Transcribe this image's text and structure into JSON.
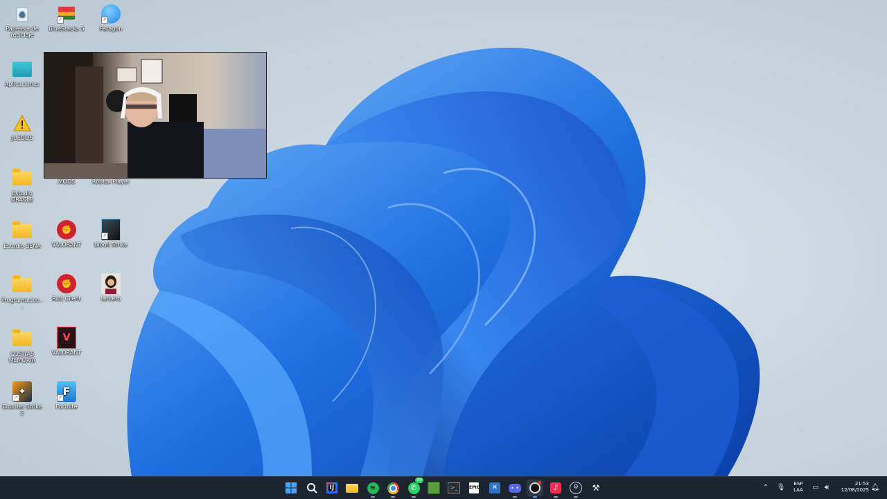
{
  "desktop_icons": [
    {
      "id": "recycle",
      "label": "Papelera de reciclaje",
      "icon": "recycle-bin-icon"
    },
    {
      "id": "bluestacks",
      "label": "BlueStacks 5",
      "icon": "bluestacks-icon"
    },
    {
      "id": "paragon",
      "label": "Paragon",
      "icon": "paragon-icon"
    },
    {
      "id": "aplicaciones",
      "label": "Aplicaciones",
      "icon": "apps-folder-icon"
    },
    {
      "id": "juegos",
      "label": "JUEGOS",
      "icon": "warning-icon"
    },
    {
      "id": "estudio_oracle",
      "label": "Estudio ORACLE",
      "icon": "folder-icon"
    },
    {
      "id": "mods",
      "label": "MODS",
      "icon": "mods-icon"
    },
    {
      "id": "roblox",
      "label": "Roblox Player",
      "icon": "roblox-icon"
    },
    {
      "id": "estudio_sena",
      "label": "Estudio SENA",
      "icon": "folder-icon"
    },
    {
      "id": "valorant1",
      "label": "VALORANT",
      "icon": "riot-icon"
    },
    {
      "id": "bloodstrike",
      "label": "Blood Strike",
      "icon": "bloodstrike-icon"
    },
    {
      "id": "programacion",
      "label": "Programacion...",
      "icon": "folder-icon"
    },
    {
      "id": "riotclient",
      "label": "Riot Client",
      "icon": "riot-icon"
    },
    {
      "id": "tercero",
      "label": "tercero",
      "icon": "avatar-icon"
    },
    {
      "id": "cositas",
      "label": "COSITAS MEMORIA",
      "icon": "folder-icon"
    },
    {
      "id": "valorant2",
      "label": "VALORANT",
      "icon": "valorant-icon"
    },
    {
      "id": "cs2",
      "label": "Counter-Strike 2",
      "icon": "cs2-icon"
    },
    {
      "id": "fortnite",
      "label": "Fortnite",
      "icon": "fortnite-icon"
    }
  ],
  "taskbar": {
    "apps": [
      {
        "name": "start",
        "icon": "windows-start-icon",
        "color": "#3a8ee6"
      },
      {
        "name": "search",
        "icon": "search-icon",
        "color": "#ffffff"
      },
      {
        "name": "intellij",
        "icon": "intellij-icon",
        "color": "#5b3fd6"
      },
      {
        "name": "file-explorer",
        "icon": "folder-icon",
        "color": "#f4b71e"
      },
      {
        "name": "spotify",
        "icon": "spotify-icon",
        "color": "#1db954"
      },
      {
        "name": "chrome",
        "icon": "chrome-icon",
        "color": "#e94235"
      },
      {
        "name": "whatsapp",
        "icon": "whatsapp-icon",
        "color": "#25d366"
      },
      {
        "name": "minecraft",
        "icon": "minecraft-icon",
        "color": "#5a9b3b"
      },
      {
        "name": "terminal",
        "icon": "terminal-icon",
        "color": "#2d2d2d"
      },
      {
        "name": "epic",
        "icon": "epic-games-icon",
        "color": "#ffffff"
      },
      {
        "name": "editor",
        "icon": "editor-icon",
        "color": "#2f74c0"
      },
      {
        "name": "discord",
        "icon": "discord-icon",
        "color": "#5865f2"
      },
      {
        "name": "obs",
        "icon": "obs-icon",
        "color": "#d0d0d0"
      },
      {
        "name": "tiktok",
        "icon": "tiktok-icon",
        "color": "#fe2c55"
      },
      {
        "name": "steam",
        "icon": "steam-icon",
        "color": "#c7d5e0"
      },
      {
        "name": "tools",
        "icon": "tools-icon",
        "color": "#ffffff"
      }
    ],
    "whatsapp_badge": "99",
    "tray": {
      "lang_top": "ESP",
      "lang_bottom": "LAA",
      "time": "21:53",
      "date": "12/08/2025"
    }
  }
}
